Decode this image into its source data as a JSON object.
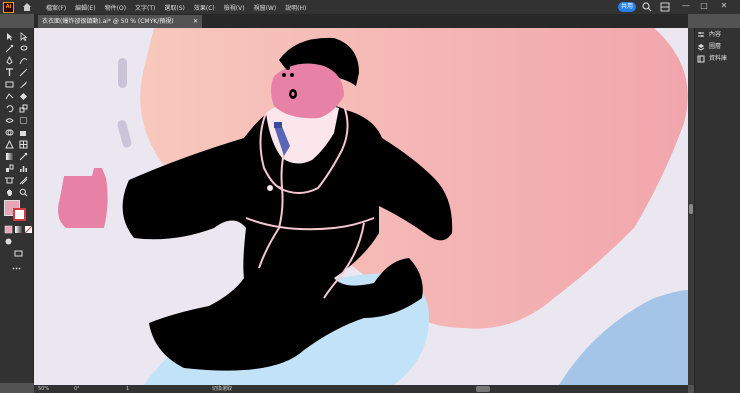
{
  "app": {
    "logo": "Ai"
  },
  "menu": [
    "檔案(F)",
    "編輯(E)",
    "物件(O)",
    "文字(T)",
    "選取(S)",
    "效果(C)",
    "檢視(V)",
    "視窗(W)",
    "說明(H)"
  ],
  "topbar": {
    "share_label": "共用",
    "icons": [
      "home-icon",
      "search-icon",
      "arrange-icon",
      "minimize-icon",
      "maximize-icon",
      "close-icon"
    ],
    "win_min": "—",
    "win_max": "□",
    "win_close": "✕"
  },
  "document_tab": {
    "title": "衣衣面(爆炸卻很鎮動).ai* @ 50 % (CMYK/預視)",
    "close": "✕"
  },
  "right_panel": {
    "items": [
      "內容",
      "圖層",
      "資料庫"
    ]
  },
  "status": {
    "zoom": "50%",
    "rotation": "0°",
    "artboard": "1",
    "tool_name": "切換選取"
  },
  "colors": {
    "accent": "#2680eb",
    "fill_swatch": "#e8a5b8",
    "canvas_bg": "#ebe7f1",
    "pink_blob": "#f3b4ad",
    "blue_blob": "#c2e2f7",
    "suit": "#000000",
    "face": "#e782a6"
  }
}
